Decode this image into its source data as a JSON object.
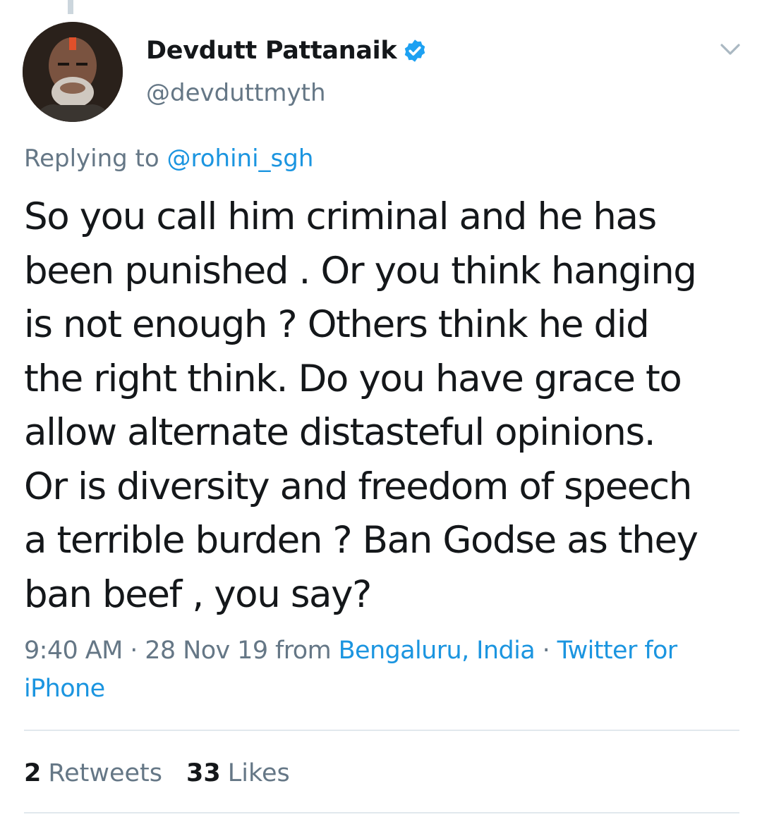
{
  "tweet": {
    "author": {
      "display_name": "Devdutt Pattanaik",
      "handle": "@devduttmyth",
      "verified": true,
      "avatar_icon": "profile-photo"
    },
    "menu_icon": "chevron-down-icon",
    "replying_label": "Replying to",
    "replying_to": "@rohini_sgh",
    "text_lines": [
      "So you call him criminal and he has",
      "been punished . Or you think hanging",
      "is not enough ? Others think he did",
      "the right think. Do you have grace to",
      "allow alternate distasteful opinions.",
      "Or is diversity and freedom of speech",
      "a terrible burden ? Ban Godse as they",
      "ban beef , you say?"
    ],
    "time": "9:40 AM",
    "separator": "·",
    "date": "28 Nov 19",
    "from_label": "from",
    "location": "Bengaluru, India",
    "source_part1": "Twitter for",
    "source_part2": "iPhone",
    "retweets_count": "2",
    "retweets_label": "Retweets",
    "likes_count": "33",
    "likes_label": "Likes"
  },
  "colors": {
    "text": "#14171a",
    "muted": "#657786",
    "link": "#1b95e0",
    "divider": "#e1e8ed",
    "verified_badge": "#1da1f2"
  }
}
